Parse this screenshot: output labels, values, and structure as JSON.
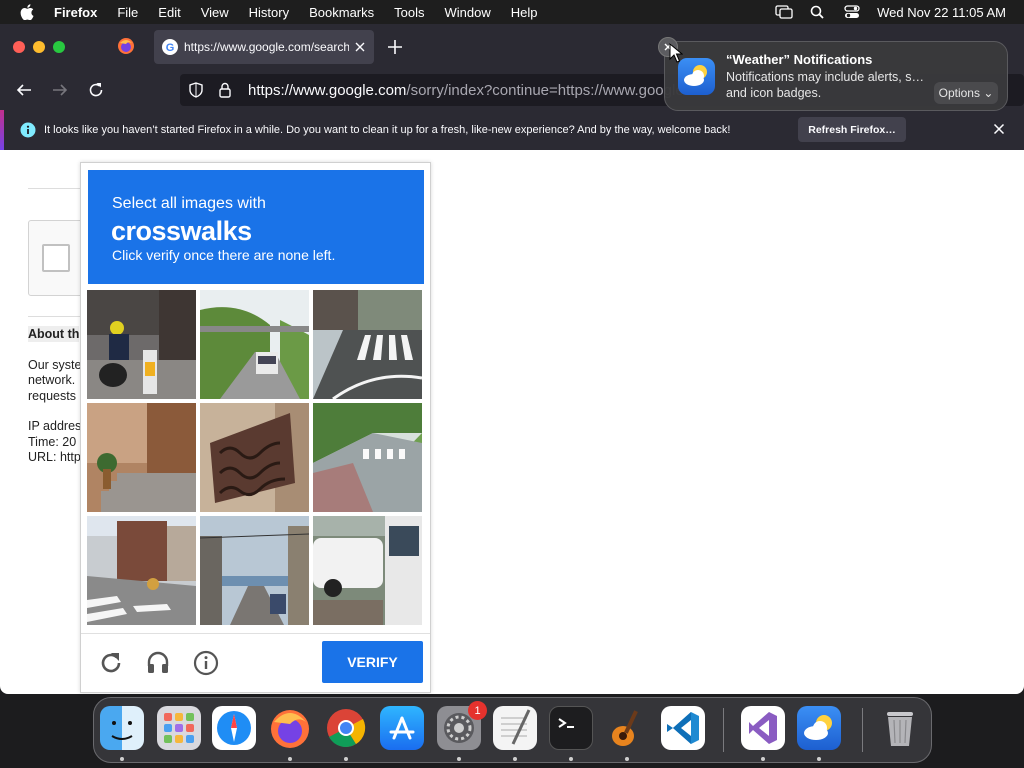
{
  "menubar": {
    "app_name": "Firefox",
    "items": [
      "File",
      "Edit",
      "View",
      "History",
      "Bookmarks",
      "Tools",
      "Window",
      "Help"
    ],
    "clock": "Wed Nov 22  11:05 AM"
  },
  "browser": {
    "active_tab_title": "https://www.google.com/search?",
    "url_host": "https://www.google.com",
    "url_rest": "/sorry/index?continue=https://www.google"
  },
  "infobar": {
    "message": "It looks like you haven’t started Firefox in a while. Do you want to clean it up for a fresh, like-new experience? And by the way, welcome back!",
    "button_label": "Refresh Firefox…"
  },
  "page": {
    "about_heading": "About th",
    "para_lines": [
      "Our syste",
      "network.",
      "requests"
    ],
    "info_lines": [
      "IP addres",
      "Time: 20",
      "URL: http"
    ]
  },
  "captcha": {
    "line1": "Select all images with",
    "target": "crosswalks",
    "line3": "Click verify once there are none left.",
    "verify_label": "VERIFY",
    "tiles": [
      "motorcycle-street",
      "highway-truck",
      "crosswalk-road",
      "building-steps",
      "ornate-balcony",
      "tree-lined-crosswalk",
      "residential-crosswalk",
      "street-hill-view",
      "white-cars-bus"
    ]
  },
  "notification": {
    "title": "“Weather” Notifications",
    "body": "Notifications may include alerts, s… and icon badges.",
    "options_label": "Options"
  },
  "dock": {
    "badge_count": "1",
    "apps": [
      "finder",
      "launchpad",
      "safari",
      "firefox",
      "chrome",
      "app-store",
      "system-settings",
      "textedit",
      "terminal",
      "garageband",
      "vscode",
      "visual-studio",
      "weather",
      "trash"
    ]
  }
}
